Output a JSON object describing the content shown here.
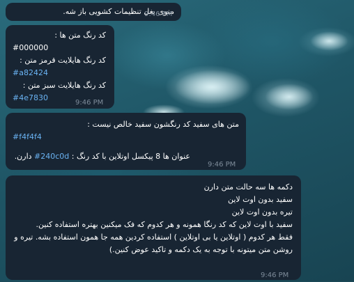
{
  "messages": [
    {
      "lines": [
        "منوی بغل تنظیمات کشویی باز شه."
      ],
      "time": "9:46 PM"
    },
    {
      "lines": [
        "کد رنگ متن ها :",
        "#000000",
        "کد رنگ هایلایت قرمز متن :",
        "#a82424",
        "کد رنگ هایلایت سبز متن :",
        "#4e7830"
      ],
      "time": "9:46 PM"
    },
    {
      "line1": "متن های سفید کد رنگشون سفید خالص نیست  :",
      "hex": "#f4f4f4",
      "line3_before": "عنوان ها 8 پیکسل اوتلاین با کد رنگ : ",
      "line3_hex": "#240c0d",
      "line3_after": " دارن.",
      "time": "9:46 PM"
    },
    {
      "lines": [
        "دکمه ها سه حالت متن دارن",
        "سفید بدون اوت لاین",
        "تیره بدون اوت لاین",
        "سفید با اوت لاین که کد رنگا همونه و هر کدوم که فک میکنین بهتره استفاده کنین.",
        "فقط هر کدوم ( اوتلاین یا بی اوتلاین ) استفاده کردین همه جا همون استفاده بشه. تیره و روشن متن میتونه با توجه به یک دکمه و تاکید عوض کنین.)"
      ],
      "time": "9:46 PM"
    }
  ],
  "colors": {
    "bubble": "#182533",
    "link": "#6ab3f3",
    "time": "#7e8c9a",
    "text": "#ffffff"
  }
}
